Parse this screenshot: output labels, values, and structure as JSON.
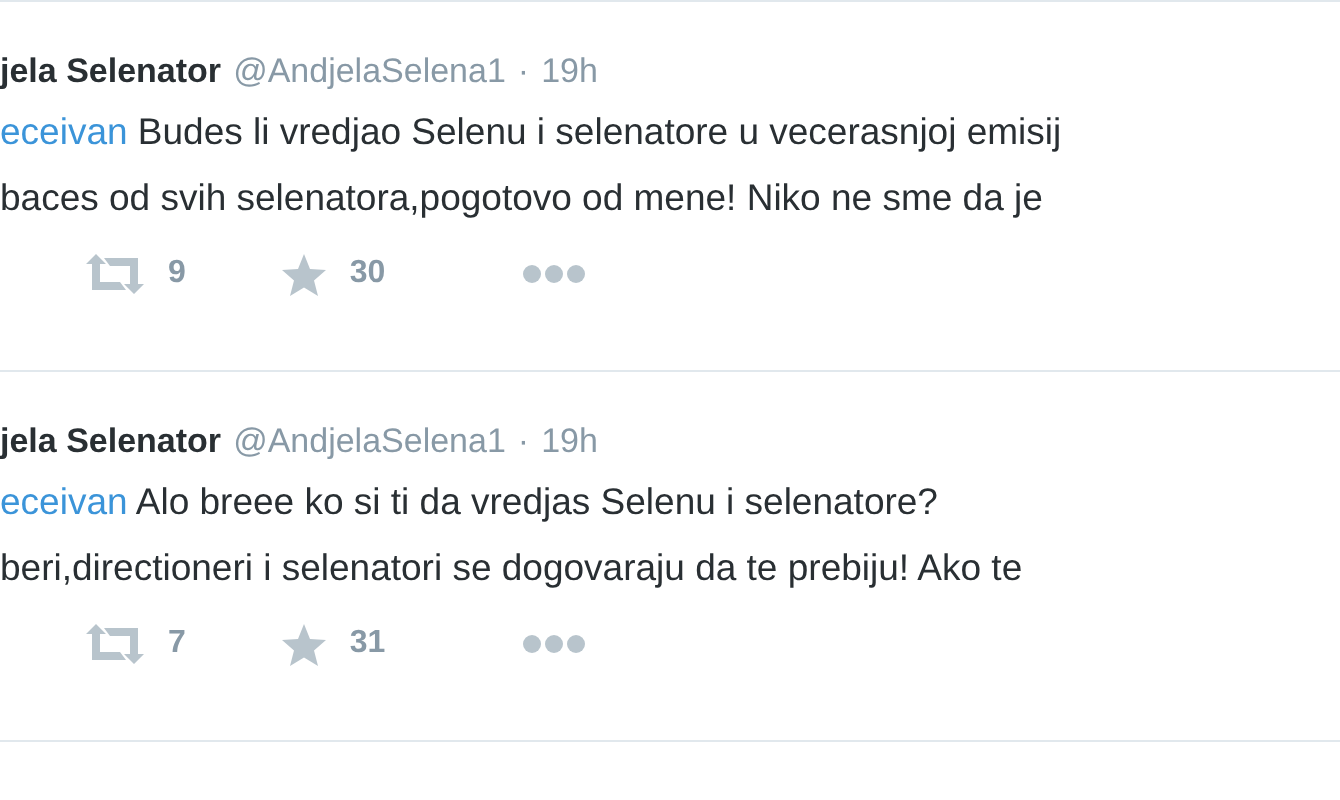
{
  "tweets": [
    {
      "name": "jela Selenator",
      "handle": "@AndjelaSelena1",
      "separator": "·",
      "time": "19h",
      "mention": "eceivan",
      "lines": [
        "Budes li vredjao Selenu i selenatore u vecerasnjoj emisij",
        "baces od svih selenatora,pogotovo od mene! Niko ne sme da je"
      ],
      "retweets": "9",
      "favorites": "30"
    },
    {
      "name": "jela Selenator",
      "handle": "@AndjelaSelena1",
      "separator": "·",
      "time": "19h",
      "mention": "eceivan",
      "lines": [
        "Alo breee ko si ti da vredjas Selenu i selenatore?",
        "beri,directioneri i selenatori se dogovaraju da te prebiju! Ako te"
      ],
      "retweets": "7",
      "favorites": "31"
    }
  ]
}
